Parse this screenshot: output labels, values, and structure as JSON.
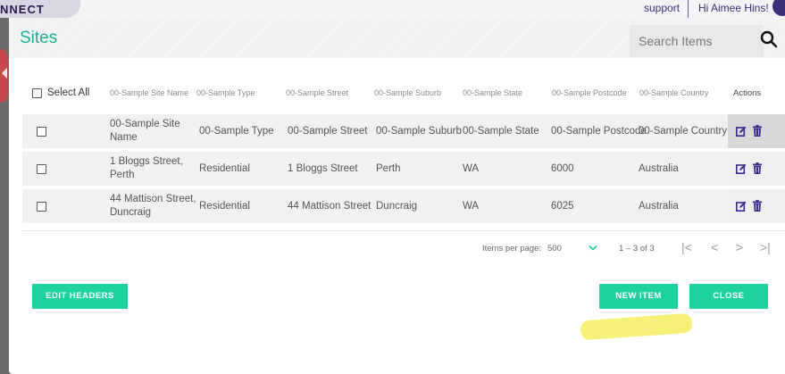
{
  "background": {
    "brand": "NNECT",
    "support": "support",
    "greeting": "Hi Aimee Hins!"
  },
  "dialog": {
    "title": "Sites",
    "search": {
      "placeholder": "Search Items"
    },
    "table": {
      "select_all": "Select All",
      "headers": [
        "00-Sample Site Name",
        "00-Sample Type",
        "00-Sample Street",
        "00-Sample Suburb",
        "00-Sample State",
        "00-Sample Postcode",
        "00-Sample Country",
        "Actions"
      ],
      "rows": [
        {
          "site_name": "00-Sample Site Name",
          "type": "00-Sample Type",
          "street": "00-Sample Street",
          "suburb": "00-Sample Suburb",
          "state": "00-Sample State",
          "postcode": "00-Sample Postcode",
          "country": "00-Sample Country"
        },
        {
          "site_name": "1 Bloggs Street, Perth",
          "type": "Residential",
          "street": "1 Bloggs Street",
          "suburb": "Perth",
          "state": "WA",
          "postcode": "6000",
          "country": "Australia"
        },
        {
          "site_name": "44 Mattison Street, Duncraig",
          "type": "Residential",
          "street": "44 Mattison Street",
          "suburb": "Duncraig",
          "state": "WA",
          "postcode": "6025",
          "country": "Australia"
        }
      ]
    },
    "paginator": {
      "items_per_page_label": "Items per page:",
      "items_per_page_value": "500",
      "range": "1 – 3 of 3",
      "first": "|<",
      "prev": "<",
      "next": ">",
      "last": ">|"
    },
    "buttons": {
      "edit_headers": "EDIT HEADERS",
      "new_item": "NEW ITEM",
      "close": "CLOSE"
    }
  },
  "colors": {
    "accent": "#1ed1a0",
    "title": "#16b38e",
    "action_icons": "#3c2a8c",
    "highlight": "#f5f071"
  }
}
